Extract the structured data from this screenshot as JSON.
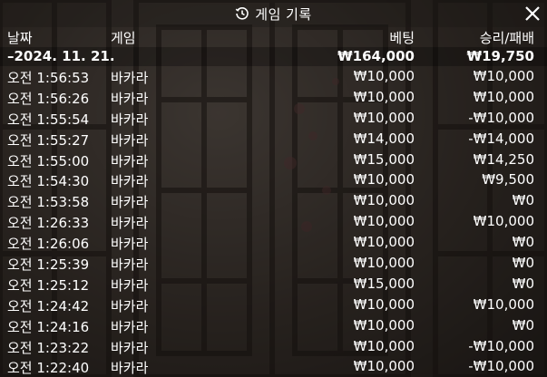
{
  "window": {
    "title": "게임 기록",
    "close_label": "✕"
  },
  "columns": {
    "date": "날짜",
    "game": "게임",
    "bet": "베팅",
    "result": "승리/패배"
  },
  "summary": {
    "date": "–2024. 11. 21.",
    "bet": "₩164,000",
    "result": "₩19,750"
  },
  "rows": [
    {
      "time": "오전 1:56:53",
      "game": "바카라",
      "bet": "₩10,000",
      "result": "₩10,000"
    },
    {
      "time": "오전 1:56:26",
      "game": "바카라",
      "bet": "₩10,000",
      "result": "₩10,000"
    },
    {
      "time": "오전 1:55:54",
      "game": "바카라",
      "bet": "₩10,000",
      "result": "-₩10,000"
    },
    {
      "time": "오전 1:55:27",
      "game": "바카라",
      "bet": "₩14,000",
      "result": "-₩14,000"
    },
    {
      "time": "오전 1:55:00",
      "game": "바카라",
      "bet": "₩15,000",
      "result": "₩14,250"
    },
    {
      "time": "오전 1:54:30",
      "game": "바카라",
      "bet": "₩10,000",
      "result": "₩9,500"
    },
    {
      "time": "오전 1:53:58",
      "game": "바카라",
      "bet": "₩10,000",
      "result": "₩0"
    },
    {
      "time": "오전 1:26:33",
      "game": "바카라",
      "bet": "₩10,000",
      "result": "₩10,000"
    },
    {
      "time": "오전 1:26:06",
      "game": "바카라",
      "bet": "₩10,000",
      "result": "₩0"
    },
    {
      "time": "오전 1:25:39",
      "game": "바카라",
      "bet": "₩10,000",
      "result": "₩0"
    },
    {
      "time": "오전 1:25:12",
      "game": "바카라",
      "bet": "₩15,000",
      "result": "₩0"
    },
    {
      "time": "오전 1:24:42",
      "game": "바카라",
      "bet": "₩10,000",
      "result": "₩10,000"
    },
    {
      "time": "오전 1:24:16",
      "game": "바카라",
      "bet": "₩10,000",
      "result": "₩0"
    },
    {
      "time": "오전 1:23:22",
      "game": "바카라",
      "bet": "₩10,000",
      "result": "-₩10,000"
    },
    {
      "time": "오전 1:22:40",
      "game": "바카라",
      "bet": "₩10,000",
      "result": "-₩10,000"
    }
  ],
  "icons": {
    "title_icon": "history-clock-icon",
    "close_icon": "close-icon"
  },
  "colors": {
    "text": "#ffffff",
    "background": "#3a332d"
  }
}
